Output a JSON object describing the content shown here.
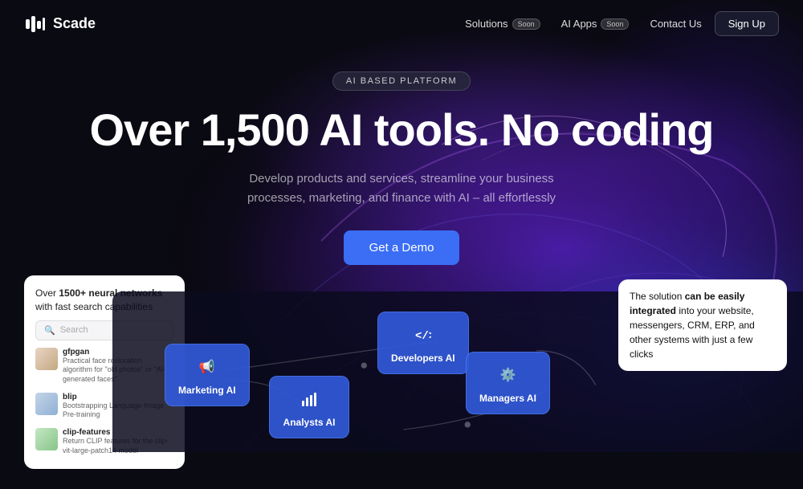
{
  "brand": {
    "name": "Scade"
  },
  "nav": {
    "links": [
      {
        "label": "Solutions",
        "badge": "Soon"
      },
      {
        "label": "AI Apps",
        "badge": "Soon"
      },
      {
        "label": "Contact Us",
        "badge": null
      }
    ],
    "signup_label": "Sign Up"
  },
  "hero": {
    "badge": "AI BASED PLATFORM",
    "title": "Over 1,500 AI tools. No coding",
    "subtitle": "Develop products and services, streamline your business processes, marketing, and finance with AI – all effortlessly",
    "cta": "Get a Demo"
  },
  "neural_card": {
    "title_plain": "Over ",
    "title_bold": "1500+ neural networks",
    "title_suffix": " with fast search capabilities",
    "search_placeholder": "Search",
    "items": [
      {
        "name": "gfpgan",
        "desc": "Practical face restoration algorithm for \"old photos\" or \"AI-generated faces\""
      },
      {
        "name": "blip",
        "desc": "Bootstrapping Language-Image Pre-training"
      },
      {
        "name": "clip-features",
        "desc": "Return CLIP features for the clip-vit-large-patch14 model"
      }
    ]
  },
  "flow_nodes": [
    {
      "id": "marketing",
      "label": "Marketing AI",
      "icon": "📢"
    },
    {
      "id": "analysts",
      "label": "Analysts AI",
      "icon": "📊"
    },
    {
      "id": "developers",
      "label": "Developers AI",
      "icon": "</>"
    },
    {
      "id": "managers",
      "label": "Managers AI",
      "icon": "⚙️"
    }
  ],
  "integration_card": {
    "text_plain": "The solution ",
    "text_bold": "can be easily integrated",
    "text_suffix": " into your website, messengers, CRM, ERP, and other systems with just a few clicks"
  },
  "colors": {
    "accent_blue": "#3b6ef5",
    "nav_bg": "#0a0a12",
    "node_bg": "rgba(50,90,220,0.9)"
  }
}
